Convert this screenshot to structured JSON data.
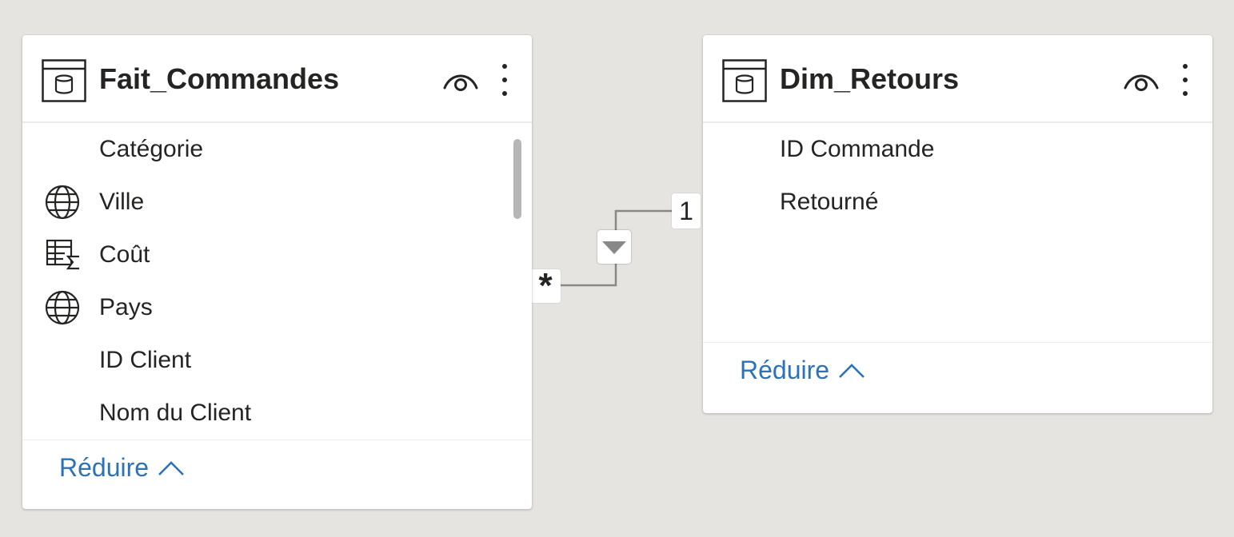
{
  "tables": [
    {
      "title": "Fait_Commandes",
      "fields": [
        {
          "label": "Catégorie",
          "icon": ""
        },
        {
          "label": "Ville",
          "icon": "globe-icon"
        },
        {
          "label": "Coût",
          "icon": "sum-table-icon"
        },
        {
          "label": "Pays",
          "icon": "globe-icon"
        },
        {
          "label": "ID Client",
          "icon": ""
        },
        {
          "label": "Nom du Client",
          "icon": ""
        }
      ],
      "collapse_label": "Réduire"
    },
    {
      "title": "Dim_Retours",
      "fields": [
        {
          "label": "ID Commande",
          "icon": ""
        },
        {
          "label": "Retourné",
          "icon": ""
        }
      ],
      "collapse_label": "Réduire"
    }
  ],
  "relationship": {
    "many_side": "*",
    "one_side": "1",
    "filter_icon": "triangle-down-icon"
  },
  "colors": {
    "canvas": "#e6e4e1",
    "link": "#2b72b9",
    "line": "#8a8886"
  }
}
